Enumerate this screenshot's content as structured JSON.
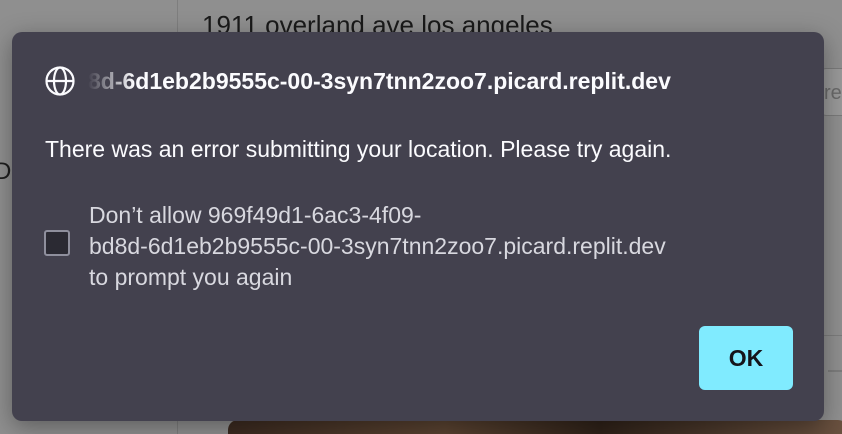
{
  "background": {
    "address_text": "1911 overland ave los angeles",
    "input_fragment": "re",
    "left_glyph": "D"
  },
  "dialog": {
    "origin": "8d-6d1eb2b9555c-00-3syn7tnn2zoo7.picard.replit.dev",
    "icon": "globe-icon",
    "message": "There was an error submitting your location. Please try again.",
    "checkbox": {
      "checked": false,
      "label_lines": [
        "Don’t allow 969f49d1-6ac3-4f09-",
        "bd8d-6d1eb2b9555c-00-3syn7tnn2zoo7.picard.replit.dev",
        "to prompt you again"
      ]
    },
    "ok_label": "OK"
  },
  "colors": {
    "dialog_bg": "#43414e",
    "accent": "#80ebff",
    "text": "#fbfbfe"
  }
}
